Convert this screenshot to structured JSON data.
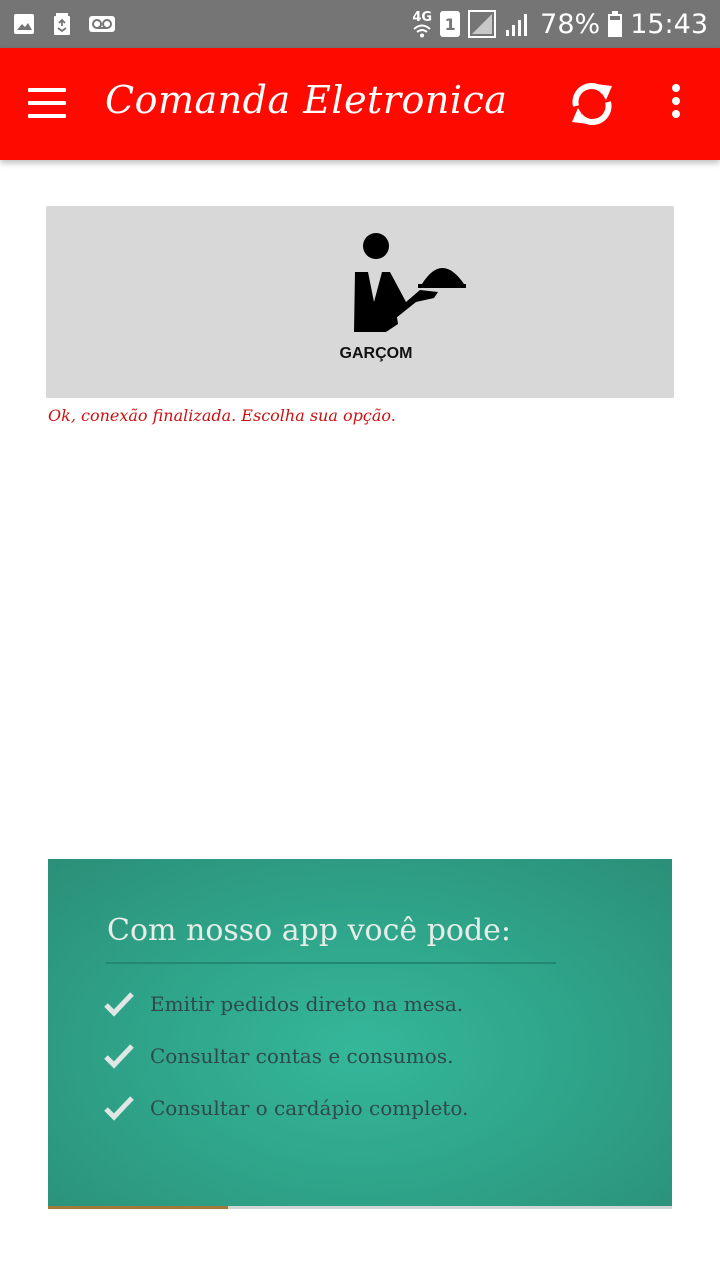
{
  "status_bar": {
    "battery_percent": "78%",
    "time": "15:43",
    "network_type": "4G",
    "sim_slot": "1",
    "icons": [
      "gallery-icon",
      "recycle-icon",
      "voicemail-icon",
      "wifi-icon",
      "signal-icon",
      "battery-icon"
    ]
  },
  "app_bar": {
    "title": "Comanda Eletronica",
    "menu_icon": "hamburger-menu-icon",
    "refresh_icon": "refresh-icon",
    "overflow_icon": "more-vert-icon"
  },
  "waiter_card": {
    "label": "GARÇOM",
    "icon": "waiter-icon"
  },
  "status_message": "Ok, conexão finalizada. Escolha sua opção.",
  "promo": {
    "heading": "Com nosso app você pode:",
    "items": [
      "Emitir pedidos direto na mesa.",
      "Consultar contas e consumos.",
      "Consultar o cardápio completo."
    ]
  },
  "colors": {
    "app_bar": "#ff0a00",
    "status_bar": "#757575",
    "card_bg": "#d8d8d8",
    "message": "#cc1111",
    "promo_bg": "#2fa68b"
  }
}
